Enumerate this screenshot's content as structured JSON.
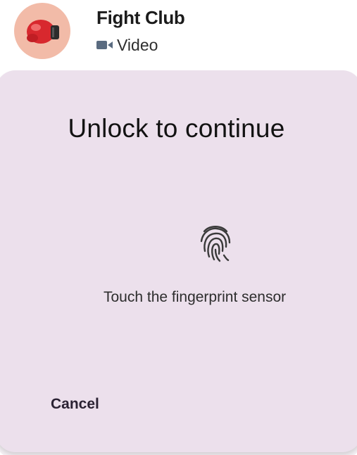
{
  "chat_header": {
    "title": "Fight Club",
    "subtitle": "Video",
    "avatar_icon": "boxing-glove-icon",
    "subtitle_icon": "video-icon"
  },
  "biometric_prompt": {
    "title": "Unlock to continue",
    "icon": "fingerprint-icon",
    "instruction": "Touch the fingerprint sensor",
    "cancel_label": "Cancel"
  },
  "colors": {
    "sheet_background": "#ece0ec",
    "avatar_background": "#f2bba8",
    "glove_red": "#d8282e"
  }
}
